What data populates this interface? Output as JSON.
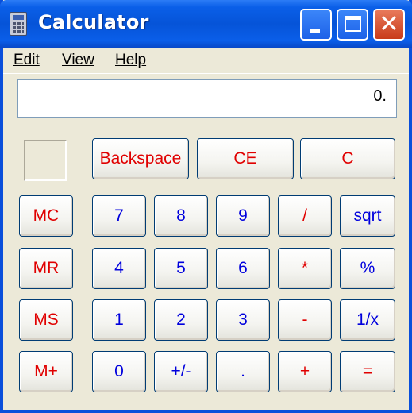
{
  "window": {
    "title": "Calculator",
    "close_glyph": "✕"
  },
  "menu": {
    "edit": "Edit",
    "view": "View",
    "help": "Help"
  },
  "display": {
    "value": "0."
  },
  "buttons": {
    "backspace": "Backspace",
    "ce": "CE",
    "c": "C",
    "mc": "MC",
    "mr": "MR",
    "ms": "MS",
    "mplus": "M+",
    "d7": "7",
    "d8": "8",
    "d9": "9",
    "div": "/",
    "sqrt": "sqrt",
    "d4": "4",
    "d5": "5",
    "d6": "6",
    "mul": "*",
    "pct": "%",
    "d1": "1",
    "d2": "2",
    "d3": "3",
    "sub": "-",
    "inv": "1/x",
    "d0": "0",
    "sign": "+/-",
    "dot": ".",
    "add": "+",
    "eq": "="
  },
  "colors": {
    "title_bar": "#0654D8",
    "operator_text": "#E00000",
    "digit_text": "#0000DD",
    "window_bg": "#ECE9D8"
  },
  "icons": {
    "app": "calculator-icon",
    "minimize": "minimize-icon",
    "maximize": "maximize-icon",
    "close": "close-icon"
  }
}
